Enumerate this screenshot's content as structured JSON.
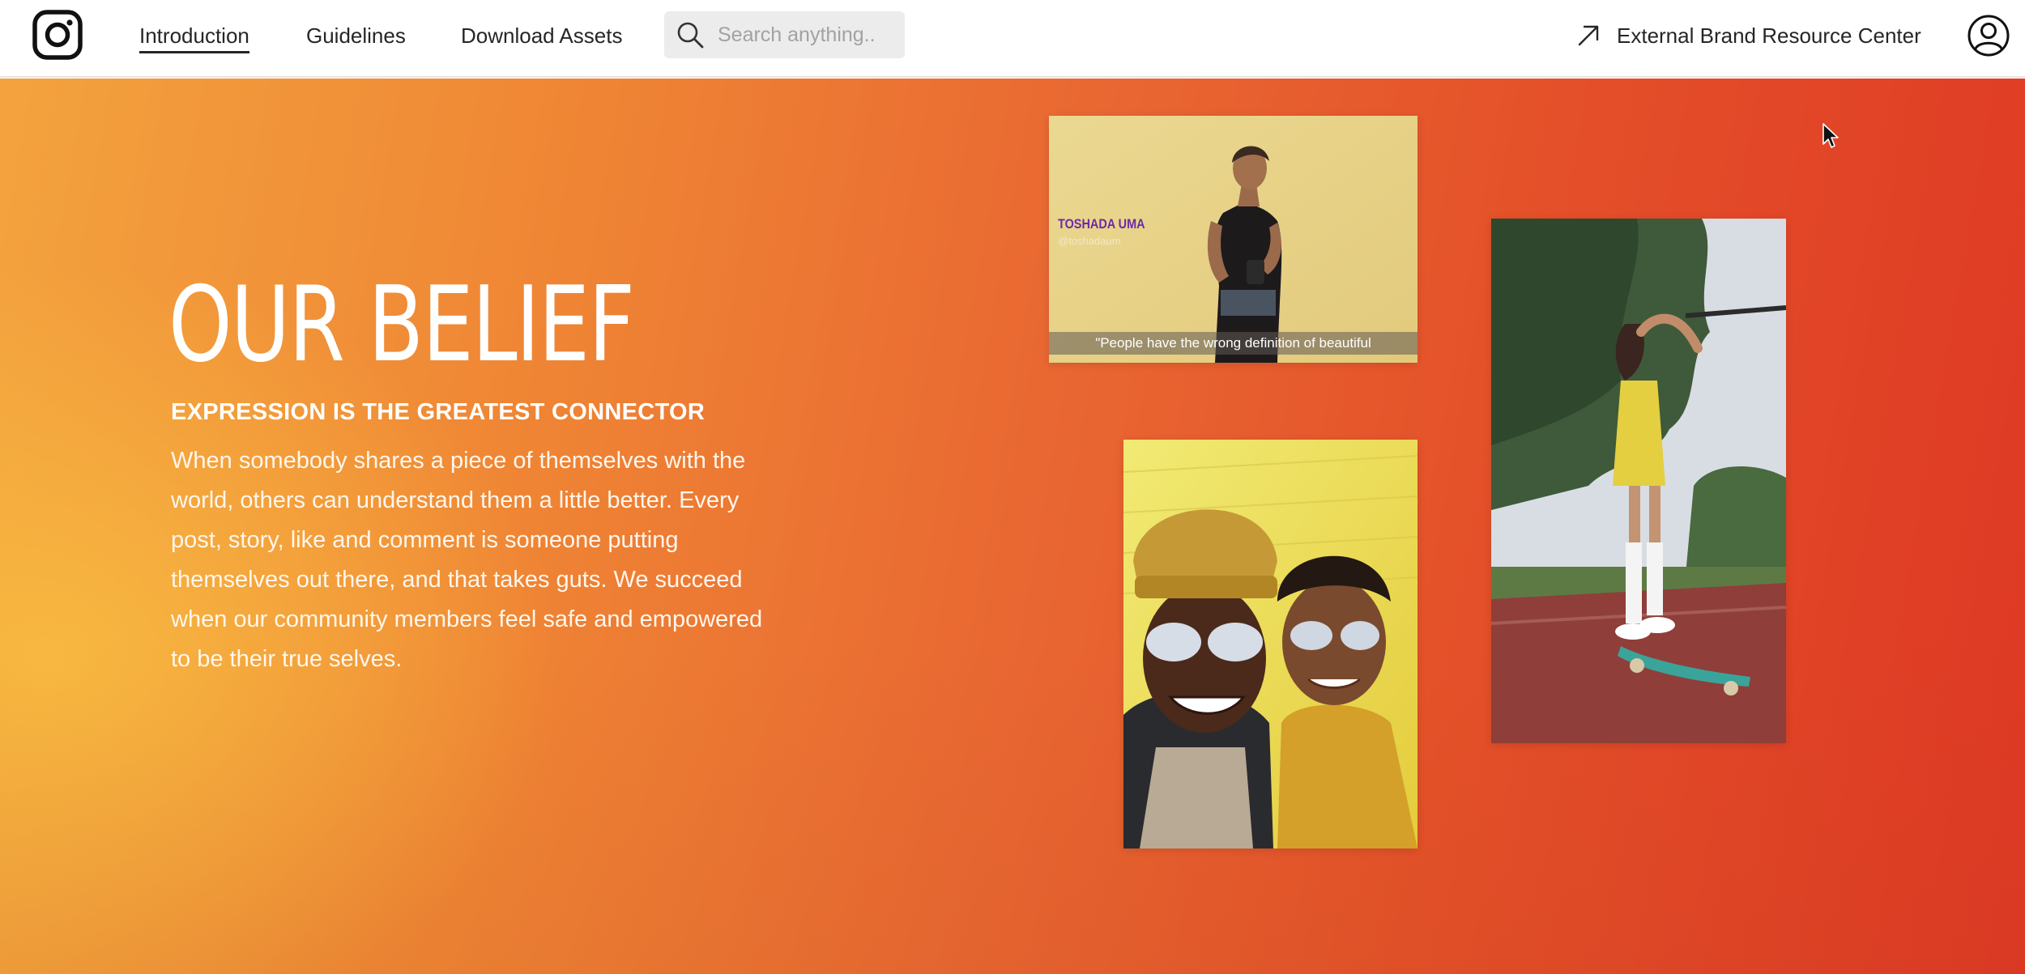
{
  "brand": {
    "logo_icon": "instagram-logo-icon"
  },
  "nav": {
    "items": [
      {
        "label": "Introduction",
        "active": true
      },
      {
        "label": "Guidelines",
        "active": false
      },
      {
        "label": "Download Assets",
        "active": false
      }
    ],
    "search": {
      "placeholder": "Search anything..",
      "value": "",
      "icon": "search-icon"
    },
    "external_link": {
      "label": "External Brand Resource Center",
      "icon": "arrow-up-right-icon"
    },
    "account_icon": "user-account-icon"
  },
  "hero": {
    "title": "OUR BELIEF",
    "subtitle": "EXPRESSION IS THE GREATEST CONNECTOR",
    "body": "When somebody shares a piece of themselves with the world, others can understand them a little better. Every post, story, like and comment is someone putting themselves out there, and that takes guts. We succeed when our community members feel safe and empowered to be their true selves."
  },
  "media": {
    "video_card": {
      "name": "TOSHADA UMA",
      "handle": "@toshadaum",
      "caption": "\"People have the wrong definition of beautiful"
    }
  },
  "colors": {
    "gradient_start": "#f3a33e",
    "gradient_end": "#de3824",
    "nav_text": "#262626",
    "accent_purple": "#6e2aa8"
  }
}
